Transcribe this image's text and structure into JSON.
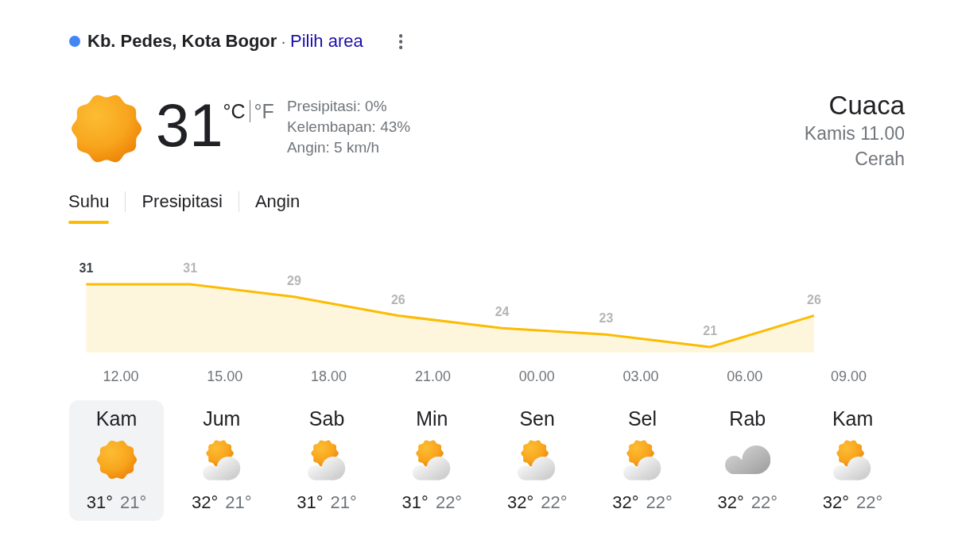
{
  "location": {
    "name": "Kb. Pedes, Kota Bogor",
    "separator": "·",
    "link": "Pilih area"
  },
  "current": {
    "kind": "sunny",
    "temperature": "31",
    "units": [
      {
        "label": "°C",
        "selected": true
      },
      {
        "label": "°F",
        "selected": false
      }
    ],
    "details": [
      "Presipitasi: 0%",
      "Kelembapan: 43%",
      "Angin: 5 km/h"
    ],
    "title": "Cuaca",
    "time": "Kamis 11.00",
    "condition": "Cerah"
  },
  "tabs": [
    {
      "label": "Suhu",
      "selected": true
    },
    {
      "label": "Presipitasi",
      "selected": false
    },
    {
      "label": "Angin",
      "selected": false
    }
  ],
  "chart": {
    "chart_data": {
      "type": "area",
      "categories": [
        null,
        "12.00",
        null,
        null,
        "15.00",
        null,
        null,
        "18.00",
        null,
        null,
        "21.00",
        null,
        null,
        "00.00",
        null,
        null,
        "03.00",
        null,
        null,
        "06.00",
        null,
        null,
        "09.00",
        null
      ],
      "series": [
        {
          "color": "#fbbc04",
          "values": [
            31,
            null,
            null,
            31,
            null,
            null,
            29,
            null,
            null,
            26,
            null,
            null,
            24,
            null,
            null,
            23,
            null,
            null,
            21,
            null,
            null,
            26,
            null,
            null
          ]
        }
      ],
      "data_labels": true
    },
    "label_states": [
      {
        "current": true
      },
      {
        "current": false
      },
      {
        "current": false
      },
      {
        "current": false
      },
      {
        "current": false
      },
      {
        "current": false
      },
      {
        "current": false
      },
      {
        "current": false
      }
    ]
  },
  "days": [
    {
      "day": "Kam",
      "kind": "sunny",
      "high": "31°",
      "low": "21°",
      "selected": true
    },
    {
      "day": "Jum",
      "kind": "partly-cloudy",
      "high": "32°",
      "low": "21°",
      "selected": false
    },
    {
      "day": "Sab",
      "kind": "partly-cloudy",
      "high": "31°",
      "low": "21°",
      "selected": false
    },
    {
      "day": "Min",
      "kind": "partly-cloudy",
      "high": "31°",
      "low": "22°",
      "selected": false
    },
    {
      "day": "Sen",
      "kind": "partly-cloudy",
      "high": "32°",
      "low": "22°",
      "selected": false
    },
    {
      "day": "Sel",
      "kind": "partly-cloudy",
      "high": "32°",
      "low": "22°",
      "selected": false
    },
    {
      "day": "Rab",
      "kind": "cloudy",
      "high": "32°",
      "low": "22°",
      "selected": false
    },
    {
      "day": "Kam",
      "kind": "partly-cloudy",
      "high": "32°",
      "low": "22°",
      "selected": false
    }
  ]
}
